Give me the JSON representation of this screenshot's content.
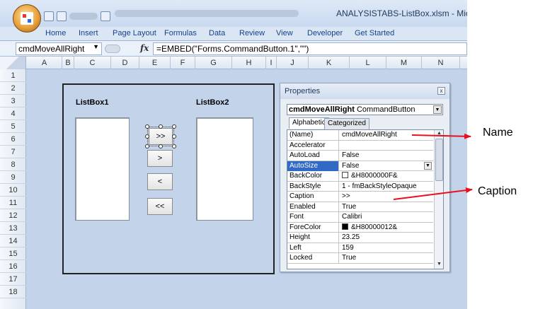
{
  "window": {
    "title": "ANALYSISTABS-ListBox.xlsm - Microsoft Ex"
  },
  "ribbon_tabs": [
    "Home",
    "Insert",
    "Page Layout",
    "Formulas",
    "Data",
    "Review",
    "View",
    "Developer",
    "Get Started"
  ],
  "formula_bar": {
    "name_box": "cmdMoveAllRight",
    "fx": "fx",
    "formula": "=EMBED(\"Forms.CommandButton.1\",\"\")"
  },
  "columns": [
    "A",
    "B",
    "C",
    "D",
    "E",
    "F",
    "G",
    "H",
    "I",
    "J",
    "K",
    "L",
    "M",
    "N"
  ],
  "rows": [
    "1",
    "2",
    "3",
    "4",
    "5",
    "6",
    "7",
    "8",
    "9",
    "10",
    "11",
    "12",
    "13",
    "14",
    "15",
    "16",
    "17",
    "18"
  ],
  "sheet": {
    "listbox1_label": "ListBox1",
    "listbox2_label": "ListBox2",
    "buttons": [
      ">>",
      ">",
      "<",
      "<<"
    ]
  },
  "properties": {
    "title": "Properties",
    "close": "x",
    "object_name": "cmdMoveAllRight",
    "object_type": "CommandButton",
    "tabs": [
      "Alphabetic",
      "Categorized"
    ],
    "rows": [
      {
        "name": "(Name)",
        "value": "cmdMoveAllRight"
      },
      {
        "name": "Accelerator",
        "value": ""
      },
      {
        "name": "AutoLoad",
        "value": "False"
      },
      {
        "name": "AutoSize",
        "value": "False"
      },
      {
        "name": "BackColor",
        "value": "&H8000000F&"
      },
      {
        "name": "BackStyle",
        "value": "1 - fmBackStyleOpaque"
      },
      {
        "name": "Caption",
        "value": ">>"
      },
      {
        "name": "Enabled",
        "value": "True"
      },
      {
        "name": "Font",
        "value": "Calibri"
      },
      {
        "name": "ForeColor",
        "value": "&H80000012&"
      },
      {
        "name": "Height",
        "value": "23.25"
      },
      {
        "name": "Left",
        "value": "159"
      },
      {
        "name": "Locked",
        "value": "True"
      }
    ],
    "colors": {
      "backcolor": "#ffffff",
      "forecolor": "#000000",
      "selection": "#3169c6"
    }
  },
  "annotations": {
    "name": "Name",
    "caption": "Caption",
    "arrow_color": "#e8101e"
  }
}
